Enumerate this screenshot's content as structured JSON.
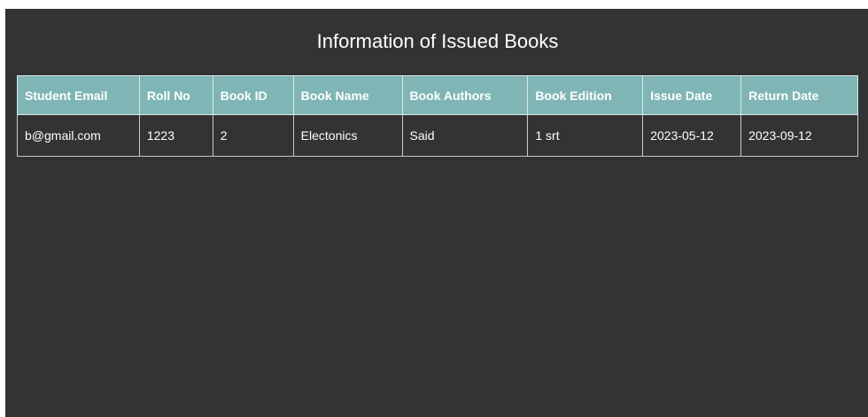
{
  "page": {
    "title": "Information of Issued Books"
  },
  "table": {
    "headers": [
      "Student Email",
      "Roll No",
      "Book ID",
      "Book Name",
      "Book Authors",
      "Book Edition",
      "Issue Date",
      "Return Date"
    ],
    "rows": [
      [
        "b@gmail.com",
        "1223",
        "2",
        "Electonics",
        "Said",
        "1 srt",
        "2023-05-12",
        "2023-09-12"
      ]
    ]
  },
  "colors": {
    "panel_background": "#333333",
    "header_background": "#7fb6b5",
    "text": "#ffffff"
  }
}
